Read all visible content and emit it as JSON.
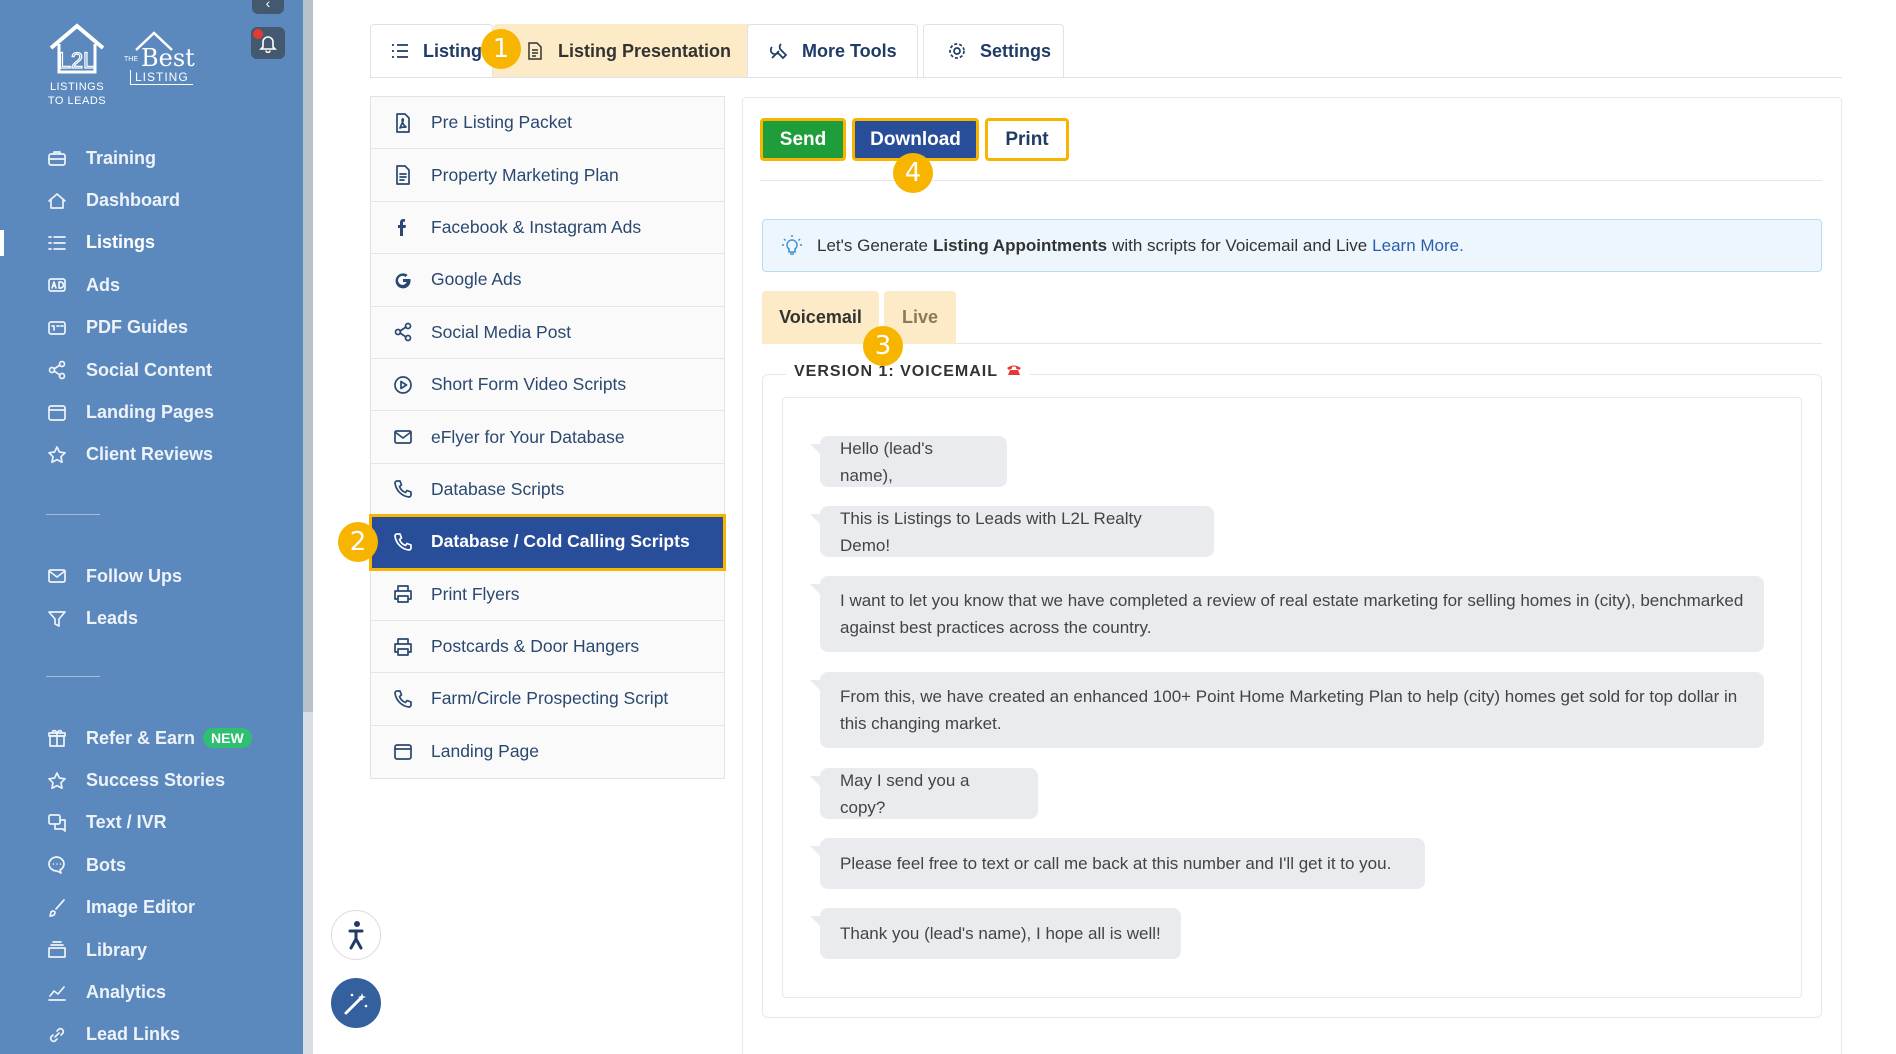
{
  "sidebar": {
    "logo_l2l_line1": "LISTINGS",
    "logo_l2l_line2": "TO LEADS",
    "logo_best_the": "THE",
    "logo_best_best": "Best",
    "logo_best_listing": "LISTING",
    "collapse_glyph": "‹",
    "items_primary": [
      {
        "label": "Training",
        "icon": "briefcase-icon"
      },
      {
        "label": "Dashboard",
        "icon": "home-icon"
      },
      {
        "label": "Listings",
        "icon": "list-icon",
        "active": true
      },
      {
        "label": "Ads",
        "icon": "ad-icon"
      },
      {
        "label": "PDF Guides",
        "icon": "pdf-icon"
      },
      {
        "label": "Social Content",
        "icon": "share-icon"
      },
      {
        "label": "Landing Pages",
        "icon": "window-icon"
      },
      {
        "label": "Client Reviews",
        "icon": "star-icon"
      }
    ],
    "items_secondary": [
      {
        "label": "Follow Ups",
        "icon": "envelope-icon"
      },
      {
        "label": "Leads",
        "icon": "funnel-icon"
      }
    ],
    "items_tertiary": [
      {
        "label": "Refer & Earn",
        "icon": "gift-icon",
        "badge": "NEW"
      },
      {
        "label": "Success Stories",
        "icon": "star-icon"
      },
      {
        "label": "Text / IVR",
        "icon": "chat-icon"
      },
      {
        "label": "Bots",
        "icon": "bot-chat-icon"
      },
      {
        "label": "Image Editor",
        "icon": "brush-icon"
      },
      {
        "label": "Library",
        "icon": "library-icon"
      },
      {
        "label": "Analytics",
        "icon": "chart-icon"
      },
      {
        "label": "Lead Links",
        "icon": "link-icon"
      }
    ]
  },
  "top_tabs": [
    {
      "label": "Listings",
      "icon": "list-icon"
    },
    {
      "label": "Listing Presentation",
      "icon": "document-icon",
      "active": true
    },
    {
      "label": "More Tools",
      "icon": "tools-icon"
    },
    {
      "label": "Settings",
      "icon": "gear-icon"
    }
  ],
  "submenu": [
    {
      "label": "Pre Listing Packet",
      "icon": "pdf-file-icon"
    },
    {
      "label": "Property Marketing Plan",
      "icon": "document-icon"
    },
    {
      "label": "Facebook & Instagram Ads",
      "icon": "facebook-icon"
    },
    {
      "label": "Google Ads",
      "icon": "google-icon"
    },
    {
      "label": "Social Media Post",
      "icon": "share-icon"
    },
    {
      "label": "Short Form Video Scripts",
      "icon": "play-icon"
    },
    {
      "label": "eFlyer for Your Database",
      "icon": "envelope-icon"
    },
    {
      "label": "Database Scripts",
      "icon": "phone-icon"
    },
    {
      "label": "Database / Cold Calling Scripts",
      "icon": "phone-icon",
      "active": true
    },
    {
      "label": "Print Flyers",
      "icon": "printer-icon"
    },
    {
      "label": "Postcards & Door Hangers",
      "icon": "printer-icon"
    },
    {
      "label": "Farm/Circle Prospecting Script",
      "icon": "phone-icon"
    },
    {
      "label": "Landing Page",
      "icon": "window-icon"
    }
  ],
  "actions": {
    "send": "Send",
    "download": "Download",
    "print": "Print"
  },
  "info": {
    "prefix": "Let's Generate",
    "bold": "Listing Appointments",
    "suffix": "with scripts for Voicemail and Live",
    "link": "Learn More."
  },
  "script_tabs": {
    "voicemail": "Voicemail",
    "live": "Live"
  },
  "version_title": "VERSION 1: VOICEMAIL",
  "messages": [
    "Hello (lead's name),",
    "This is Listings to Leads with L2L Realty Demo!",
    "I want to let you know that we have completed a review of real estate marketing for selling homes in (city), benchmarked against best practices across the country.",
    "From this, we have created an enhanced 100+ Point Home Marketing Plan to help (city) homes get sold for top dollar in this changing market.",
    "May I send you a copy?",
    "Please feel free to text or call me back at this number and I'll get it to you.",
    "Thank you (lead's name), I hope all is well!"
  ],
  "markers": [
    "1",
    "2",
    "3",
    "4"
  ],
  "colors": {
    "sidebar": "#5b88bd",
    "accent_yellow": "#f7b500",
    "active_blue": "#294e99",
    "send_green": "#1f9d3a",
    "tab_cream": "#fcebc6"
  }
}
